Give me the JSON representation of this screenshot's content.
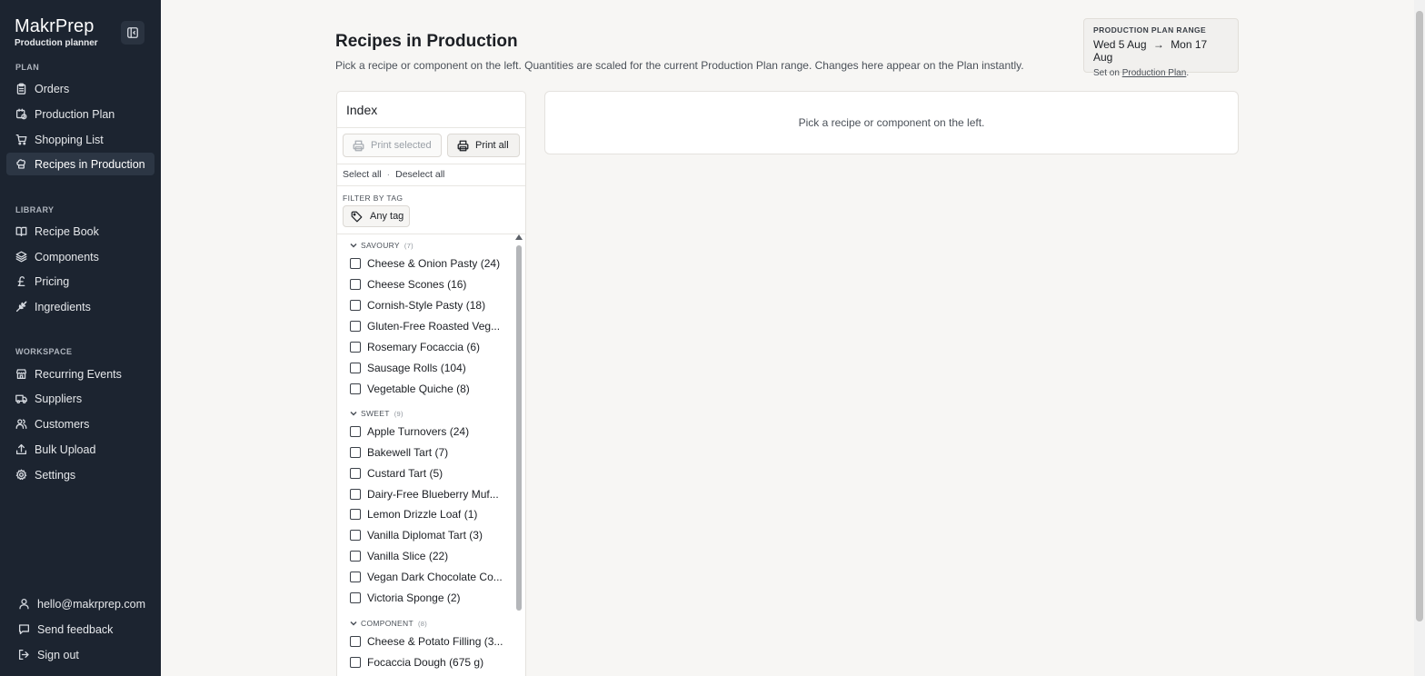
{
  "app": {
    "name": "MakrPrep",
    "subtitle": "Production planner"
  },
  "sidebar": {
    "sections": {
      "plan": "PLAN",
      "library": "LIBRARY",
      "workspace": "WORKSPACE"
    },
    "plan_items": [
      {
        "label": "Orders",
        "icon": "clipboard-icon"
      },
      {
        "label": "Production Plan",
        "icon": "calendar-clock-icon"
      },
      {
        "label": "Shopping List",
        "icon": "cart-icon"
      },
      {
        "label": "Recipes in Production",
        "icon": "chef-hat-icon",
        "active": true
      }
    ],
    "library_items": [
      {
        "label": "Recipe Book",
        "icon": "book-icon"
      },
      {
        "label": "Components",
        "icon": "layers-icon"
      },
      {
        "label": "Pricing",
        "icon": "pound-icon"
      },
      {
        "label": "Ingredients",
        "icon": "wheat-icon"
      }
    ],
    "workspace_items": [
      {
        "label": "Recurring Events",
        "icon": "store-icon"
      },
      {
        "label": "Suppliers",
        "icon": "truck-icon"
      },
      {
        "label": "Customers",
        "icon": "users-icon"
      },
      {
        "label": "Bulk Upload",
        "icon": "upload-icon"
      },
      {
        "label": "Settings",
        "icon": "gear-icon"
      }
    ],
    "footer": {
      "email": "hello@makrprep.com",
      "feedback": "Send feedback",
      "signout": "Sign out"
    }
  },
  "header": {
    "title": "Recipes in Production",
    "description": "Pick a recipe or component on the left. Quantities are scaled for the current Production Plan range. Changes here appear on the Plan instantly."
  },
  "range": {
    "label": "PRODUCTION PLAN RANGE",
    "start": "Wed 5 Aug",
    "arrow": "→",
    "end": "Mon 17 Aug",
    "note_prefix": "Set on ",
    "note_link": "Production Plan",
    "note_suffix": "."
  },
  "index": {
    "title": "Index",
    "print_selected": "Print selected",
    "print_all": "Print all",
    "select_all": "Select all",
    "separator": "·",
    "deselect_all": "Deselect all",
    "filter_label": "FILTER BY TAG",
    "tag_button": "Any tag",
    "groups": [
      {
        "name": "SAVOURY",
        "count": "(7)",
        "items": [
          {
            "name": "Cheese & Onion Pasty",
            "qty": "(24)"
          },
          {
            "name": "Cheese Scones",
            "qty": "(16)"
          },
          {
            "name": "Cornish-Style Pasty",
            "qty": "(18)"
          },
          {
            "name": "Gluten-Free Roasted Veg...",
            "qty": ""
          },
          {
            "name": "Rosemary Focaccia",
            "qty": "(6)"
          },
          {
            "name": "Sausage Rolls",
            "qty": "(104)"
          },
          {
            "name": "Vegetable Quiche",
            "qty": "(8)"
          }
        ]
      },
      {
        "name": "SWEET",
        "count": "(9)",
        "items": [
          {
            "name": "Apple Turnovers",
            "qty": "(24)"
          },
          {
            "name": "Bakewell Tart",
            "qty": "(7)"
          },
          {
            "name": "Custard Tart",
            "qty": "(5)"
          },
          {
            "name": "Dairy-Free Blueberry Muf...",
            "qty": ""
          },
          {
            "name": "Lemon Drizzle Loaf",
            "qty": "(1)"
          },
          {
            "name": "Vanilla Diplomat Tart",
            "qty": "(3)"
          },
          {
            "name": "Vanilla Slice",
            "qty": "(22)"
          },
          {
            "name": "Vegan Dark Chocolate Co...",
            "qty": ""
          },
          {
            "name": "Victoria Sponge",
            "qty": "(2)"
          }
        ]
      },
      {
        "name": "COMPONENT",
        "count": "(8)",
        "items": [
          {
            "name": "Cheese & Potato Filling (3...",
            "qty": ""
          },
          {
            "name": "Focaccia Dough",
            "qty": "(675 g)"
          }
        ]
      }
    ]
  },
  "detail": {
    "placeholder": "Pick a recipe or component on the left."
  }
}
